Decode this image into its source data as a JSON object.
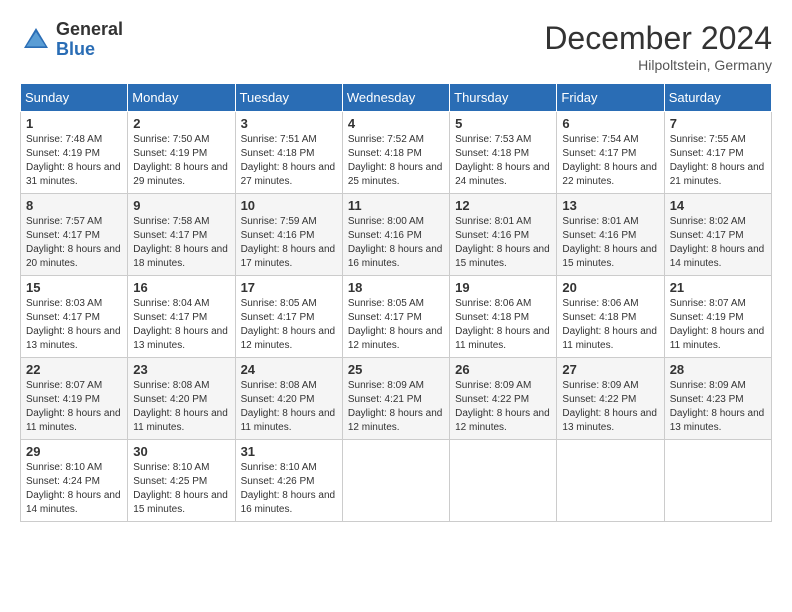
{
  "header": {
    "logo_general": "General",
    "logo_blue": "Blue",
    "month_title": "December 2024",
    "location": "Hilpoltstein, Germany"
  },
  "days_of_week": [
    "Sunday",
    "Monday",
    "Tuesday",
    "Wednesday",
    "Thursday",
    "Friday",
    "Saturday"
  ],
  "weeks": [
    [
      {
        "day": "1",
        "sunrise": "7:48 AM",
        "sunset": "4:19 PM",
        "daylight": "8 hours and 31 minutes."
      },
      {
        "day": "2",
        "sunrise": "7:50 AM",
        "sunset": "4:19 PM",
        "daylight": "8 hours and 29 minutes."
      },
      {
        "day": "3",
        "sunrise": "7:51 AM",
        "sunset": "4:18 PM",
        "daylight": "8 hours and 27 minutes."
      },
      {
        "day": "4",
        "sunrise": "7:52 AM",
        "sunset": "4:18 PM",
        "daylight": "8 hours and 25 minutes."
      },
      {
        "day": "5",
        "sunrise": "7:53 AM",
        "sunset": "4:18 PM",
        "daylight": "8 hours and 24 minutes."
      },
      {
        "day": "6",
        "sunrise": "7:54 AM",
        "sunset": "4:17 PM",
        "daylight": "8 hours and 22 minutes."
      },
      {
        "day": "7",
        "sunrise": "7:55 AM",
        "sunset": "4:17 PM",
        "daylight": "8 hours and 21 minutes."
      }
    ],
    [
      {
        "day": "8",
        "sunrise": "7:57 AM",
        "sunset": "4:17 PM",
        "daylight": "8 hours and 20 minutes."
      },
      {
        "day": "9",
        "sunrise": "7:58 AM",
        "sunset": "4:17 PM",
        "daylight": "8 hours and 18 minutes."
      },
      {
        "day": "10",
        "sunrise": "7:59 AM",
        "sunset": "4:16 PM",
        "daylight": "8 hours and 17 minutes."
      },
      {
        "day": "11",
        "sunrise": "8:00 AM",
        "sunset": "4:16 PM",
        "daylight": "8 hours and 16 minutes."
      },
      {
        "day": "12",
        "sunrise": "8:01 AM",
        "sunset": "4:16 PM",
        "daylight": "8 hours and 15 minutes."
      },
      {
        "day": "13",
        "sunrise": "8:01 AM",
        "sunset": "4:16 PM",
        "daylight": "8 hours and 15 minutes."
      },
      {
        "day": "14",
        "sunrise": "8:02 AM",
        "sunset": "4:17 PM",
        "daylight": "8 hours and 14 minutes."
      }
    ],
    [
      {
        "day": "15",
        "sunrise": "8:03 AM",
        "sunset": "4:17 PM",
        "daylight": "8 hours and 13 minutes."
      },
      {
        "day": "16",
        "sunrise": "8:04 AM",
        "sunset": "4:17 PM",
        "daylight": "8 hours and 13 minutes."
      },
      {
        "day": "17",
        "sunrise": "8:05 AM",
        "sunset": "4:17 PM",
        "daylight": "8 hours and 12 minutes."
      },
      {
        "day": "18",
        "sunrise": "8:05 AM",
        "sunset": "4:17 PM",
        "daylight": "8 hours and 12 minutes."
      },
      {
        "day": "19",
        "sunrise": "8:06 AM",
        "sunset": "4:18 PM",
        "daylight": "8 hours and 11 minutes."
      },
      {
        "day": "20",
        "sunrise": "8:06 AM",
        "sunset": "4:18 PM",
        "daylight": "8 hours and 11 minutes."
      },
      {
        "day": "21",
        "sunrise": "8:07 AM",
        "sunset": "4:19 PM",
        "daylight": "8 hours and 11 minutes."
      }
    ],
    [
      {
        "day": "22",
        "sunrise": "8:07 AM",
        "sunset": "4:19 PM",
        "daylight": "8 hours and 11 minutes."
      },
      {
        "day": "23",
        "sunrise": "8:08 AM",
        "sunset": "4:20 PM",
        "daylight": "8 hours and 11 minutes."
      },
      {
        "day": "24",
        "sunrise": "8:08 AM",
        "sunset": "4:20 PM",
        "daylight": "8 hours and 11 minutes."
      },
      {
        "day": "25",
        "sunrise": "8:09 AM",
        "sunset": "4:21 PM",
        "daylight": "8 hours and 12 minutes."
      },
      {
        "day": "26",
        "sunrise": "8:09 AM",
        "sunset": "4:22 PM",
        "daylight": "8 hours and 12 minutes."
      },
      {
        "day": "27",
        "sunrise": "8:09 AM",
        "sunset": "4:22 PM",
        "daylight": "8 hours and 13 minutes."
      },
      {
        "day": "28",
        "sunrise": "8:09 AM",
        "sunset": "4:23 PM",
        "daylight": "8 hours and 13 minutes."
      }
    ],
    [
      {
        "day": "29",
        "sunrise": "8:10 AM",
        "sunset": "4:24 PM",
        "daylight": "8 hours and 14 minutes."
      },
      {
        "day": "30",
        "sunrise": "8:10 AM",
        "sunset": "4:25 PM",
        "daylight": "8 hours and 15 minutes."
      },
      {
        "day": "31",
        "sunrise": "8:10 AM",
        "sunset": "4:26 PM",
        "daylight": "8 hours and 16 minutes."
      },
      null,
      null,
      null,
      null
    ]
  ]
}
